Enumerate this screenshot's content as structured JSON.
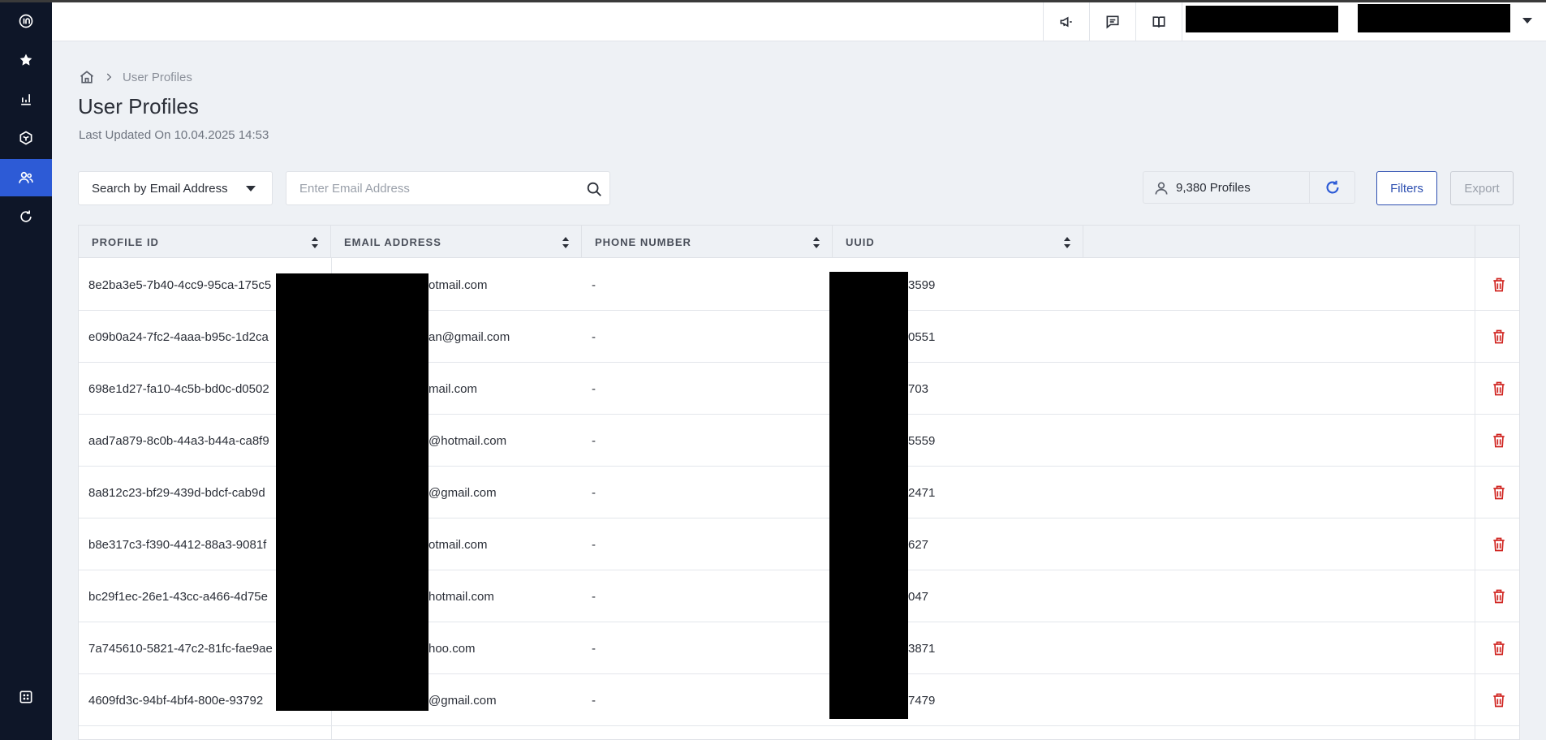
{
  "sidebar": {
    "items": [
      {
        "id": "logo",
        "icon": "insider-logo-icon"
      },
      {
        "id": "favorites",
        "icon": "star-icon"
      },
      {
        "id": "analytics",
        "icon": "bar-chart-icon"
      },
      {
        "id": "products",
        "icon": "cube-icon"
      },
      {
        "id": "users",
        "icon": "users-icon",
        "active": true
      },
      {
        "id": "refresh",
        "icon": "refresh-icon"
      },
      {
        "id": "apps",
        "icon": "apps-grid-icon"
      }
    ],
    "active_color": "#2d5bd6",
    "background": "#0e1628"
  },
  "topbar": {
    "icons": [
      "megaphone-icon",
      "chat-icon",
      "book-icon"
    ]
  },
  "breadcrumb": {
    "current": "User Profiles"
  },
  "page": {
    "title": "User Profiles",
    "last_updated": "Last Updated On 10.04.2025 14:53"
  },
  "search": {
    "type_selected": "Search by Email Address",
    "placeholder": "Enter Email Address"
  },
  "summary": {
    "profiles_count": "9,380 Profiles"
  },
  "actions": {
    "filters_label": "Filters",
    "export_label": "Export"
  },
  "table": {
    "columns": [
      "PROFILE ID",
      "EMAIL ADDRESS",
      "PHONE NUMBER",
      "UUID"
    ],
    "rows": [
      {
        "profile_id": "8e2ba3e5-7b40-4cc9-95ca-175c5",
        "email": "otmail.com",
        "phone": "-",
        "uuid": "3599"
      },
      {
        "profile_id": "e09b0a24-7fc2-4aaa-b95c-1d2ca",
        "email": "an@gmail.com",
        "phone": "-",
        "uuid": "0551"
      },
      {
        "profile_id": "698e1d27-fa10-4c5b-bd0c-d0502",
        "email": "mail.com",
        "phone": "-",
        "uuid": "703"
      },
      {
        "profile_id": "aad7a879-8c0b-44a3-b44a-ca8f9",
        "email": "@hotmail.com",
        "phone": "-",
        "uuid": "5559"
      },
      {
        "profile_id": "8a812c23-bf29-439d-bdcf-cab9d",
        "email": "@gmail.com",
        "phone": "-",
        "uuid": "2471"
      },
      {
        "profile_id": "b8e317c3-f390-4412-88a3-9081f",
        "email": "otmail.com",
        "phone": "-",
        "uuid": "627"
      },
      {
        "profile_id": "bc29f1ec-26e1-43cc-a466-4d75e",
        "email": "hotmail.com",
        "phone": "-",
        "uuid": "047"
      },
      {
        "profile_id": "7a745610-5821-47c2-81fc-fae9ae",
        "email": "hoo.com",
        "phone": "-",
        "uuid": "3871"
      },
      {
        "profile_id": "4609fd3c-94bf-4bf4-800e-93792",
        "email": "@gmail.com",
        "phone": "-",
        "uuid": "7479"
      }
    ],
    "delete_icon": "trash-icon",
    "delete_color": "#d0231f"
  }
}
